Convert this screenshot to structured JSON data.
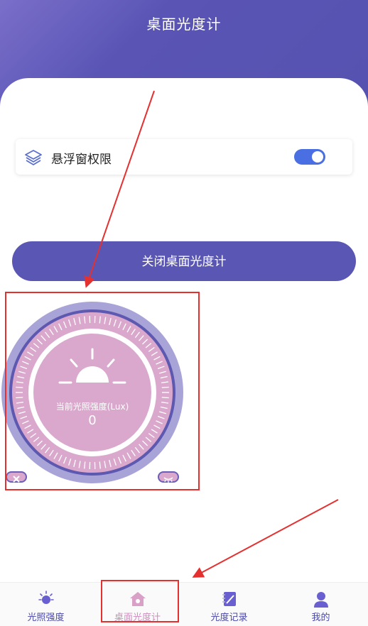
{
  "header": {
    "title": "桌面光度计"
  },
  "permission": {
    "label": "悬浮窗权限",
    "enabled": true,
    "icon": "layers-icon"
  },
  "actions": {
    "close_label": "关闭桌面光度计"
  },
  "meter": {
    "caption": "当前光照强度(Lux)",
    "value": "0",
    "close_icon": "close-icon",
    "eye_icon": "closed-eye-icon"
  },
  "tabs": [
    {
      "label": "光照强度",
      "icon": "sun-icon",
      "active": false
    },
    {
      "label": "桌面光度计",
      "icon": "home-icon",
      "active": true
    },
    {
      "label": "光度记录",
      "icon": "notebook-icon",
      "active": false
    },
    {
      "label": "我的",
      "icon": "person-icon",
      "active": false
    }
  ],
  "colors": {
    "primary": "#5a56b4",
    "accent": "#d9a8cc",
    "toggle": "#4a6fe3",
    "annotation": "#e53030"
  }
}
